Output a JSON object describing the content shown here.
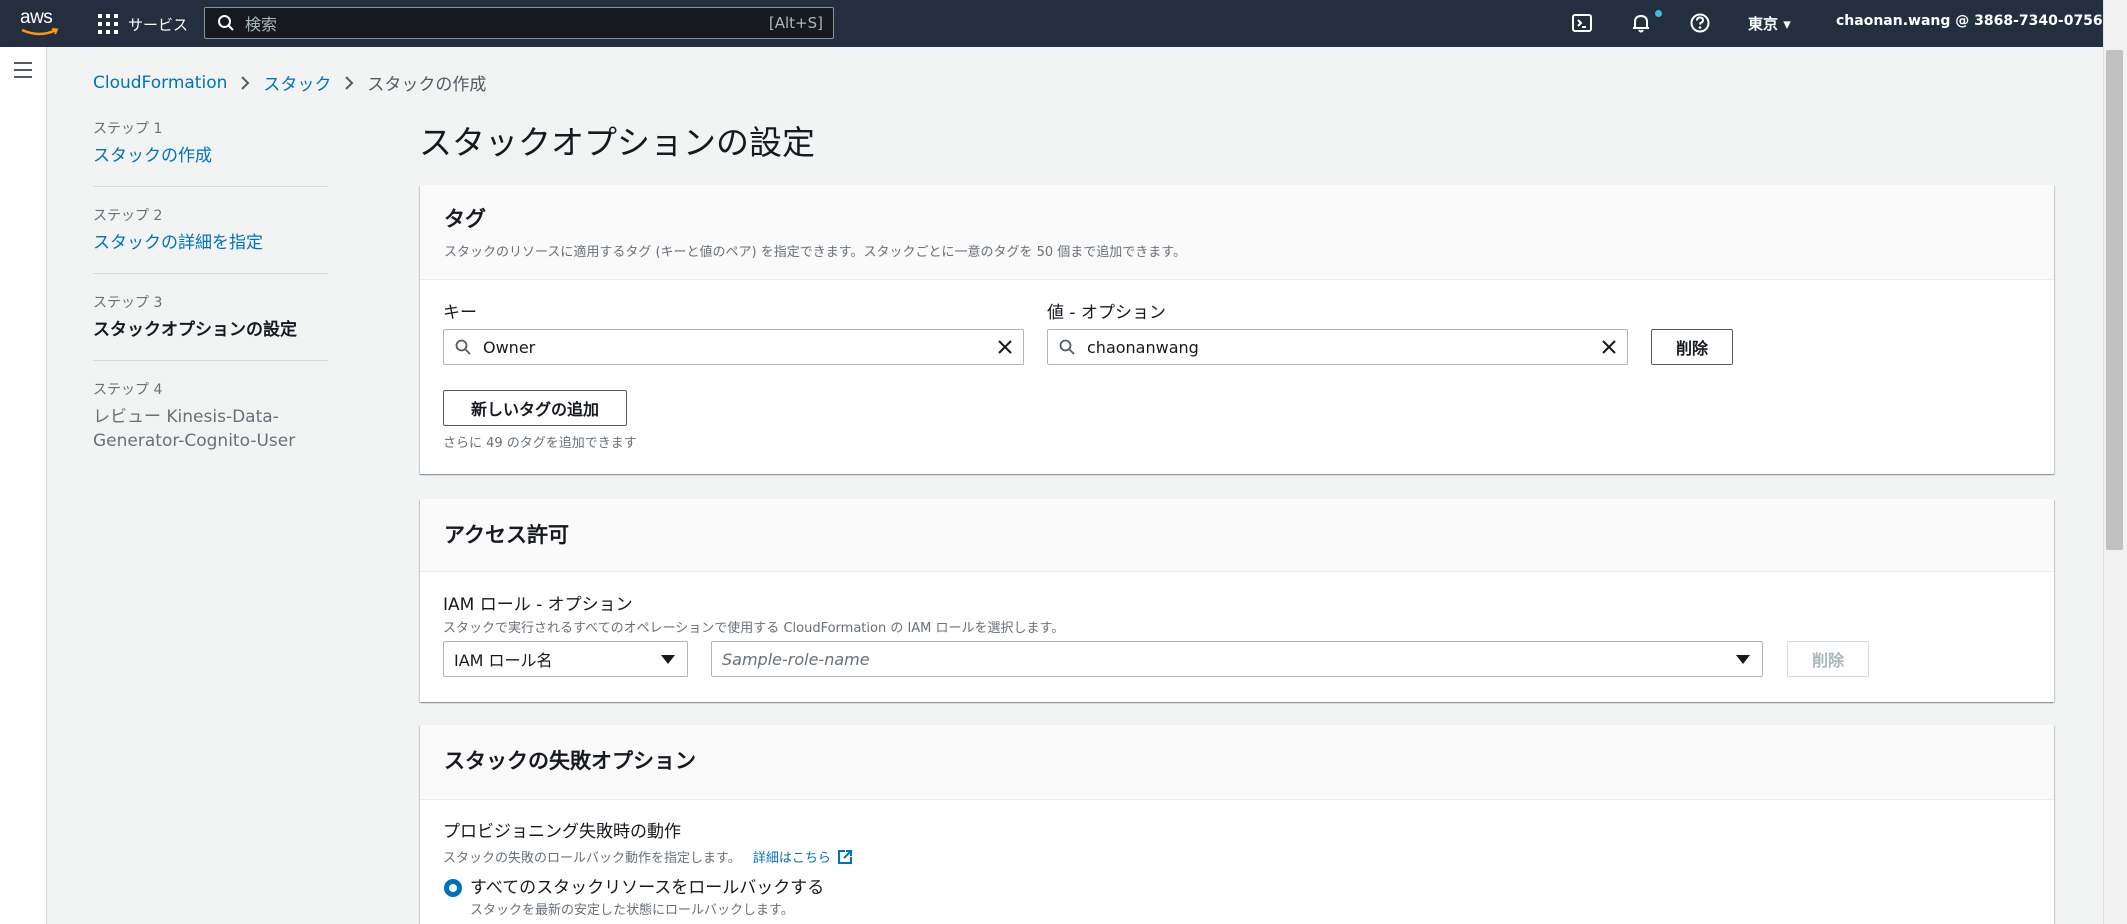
{
  "nav": {
    "logo_text": "aws",
    "services_label": "サービス",
    "search_placeholder": "検索",
    "search_shortcut": "[Alt+S]",
    "region": "東京 ▾",
    "account": "chaonan.wang @ 3868-7340-0756 ▾",
    "icons": [
      "cloudshell-icon",
      "bell-icon",
      "help-icon"
    ]
  },
  "breadcrumb": {
    "items": [
      "CloudFormation",
      "スタック",
      "スタックの作成"
    ]
  },
  "steps": [
    {
      "num": "ステップ 1",
      "label": "スタックの作成"
    },
    {
      "num": "ステップ 2",
      "label": "スタックの詳細を指定"
    },
    {
      "num": "ステップ 3",
      "label": "スタックオプションの設定"
    },
    {
      "num": "ステップ 4",
      "label_line1": "レビュー Kinesis-Data-",
      "label_line2": "Generator-Cognito-User"
    }
  ],
  "page_title": "スタックオプションの設定",
  "tags": {
    "title": "タグ",
    "description": "スタックのリソースに適用するタグ (キーと値のペア) を指定できます。スタックごとに一意のタグを 50 個まで追加できます。",
    "key_label": "キー",
    "value_label": "値 - オプション",
    "key_value": "Owner",
    "value_value": "chaonanwang",
    "remove_label": "削除",
    "add_label": "新しいタグの追加",
    "remaining": "さらに 49 のタグを追加できます"
  },
  "permissions": {
    "title": "アクセス許可",
    "iam_label": "IAM ロール - オプション",
    "iam_desc": "スタックで実行されるすべてのオペレーションで使用する CloudFormation の IAM ロールを選択します。",
    "iam_type": "IAM ロール名",
    "iam_placeholder": "Sample-role-name",
    "remove_label": "削除"
  },
  "failure": {
    "title": "スタックの失敗オプション",
    "behavior_label": "プロビジョニング失敗時の動作",
    "behavior_desc": "スタックの失敗のロールバック動作を指定します。",
    "learn_more": "詳細はこちら",
    "option1_label": "すべてのスタックリソースをロールバックする",
    "option1_desc": "スタックを最新の安定した状態にロールバックします。"
  },
  "colors": {
    "nav_bg": "#232f3e",
    "link": "#0073bb",
    "accent": "#ff9900"
  }
}
